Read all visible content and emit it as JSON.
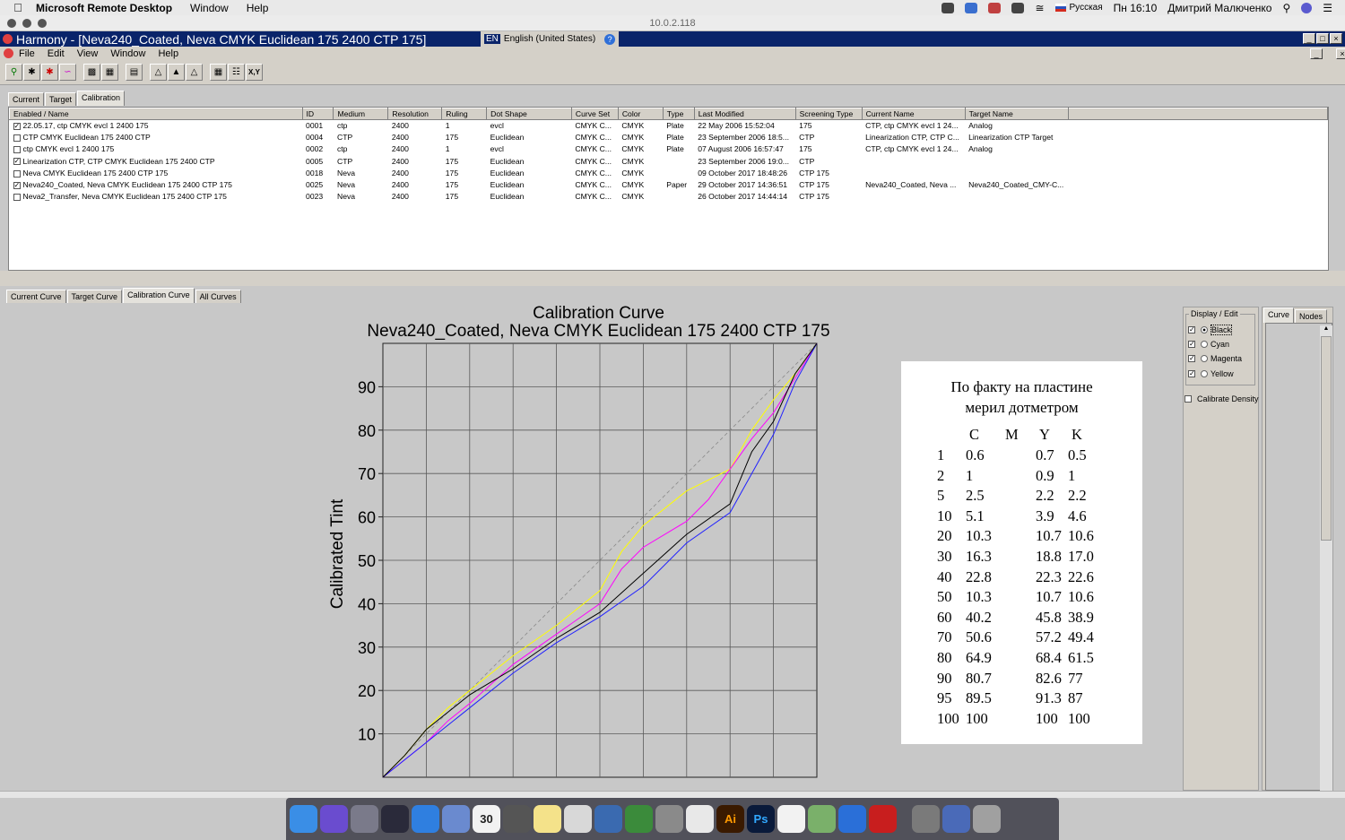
{
  "mac_menubar": {
    "app_name": "Microsoft Remote Desktop",
    "menus": [
      "Window",
      "Help"
    ],
    "input_source": "Русская",
    "clock": "Пн 16:10",
    "user": "Дмитрий Малюченко"
  },
  "rdp_title": "10.0.2.118",
  "window": {
    "title": "Harmony - [Neva240_Coated, Neva CMYK Euclidean 175 2400 CTP 175]",
    "lang_code": "EN",
    "lang_name": "English (United States)"
  },
  "menubar": [
    "File",
    "Edit",
    "View",
    "Window",
    "Help"
  ],
  "toolbar": {
    "xy_label": "X,Y"
  },
  "upper_tabs": [
    "Current",
    "Target",
    "Calibration"
  ],
  "upper_active_tab": "Calibration",
  "table": {
    "columns": [
      "Enabled / Name",
      "ID",
      "Medium",
      "Resolution",
      "Ruling",
      "Dot Shape",
      "Curve Set",
      "Color",
      "Type",
      "Last Modified",
      "Screening Type",
      "Current Name",
      "Target Name"
    ],
    "rows": [
      {
        "checked": true,
        "cells": [
          "22.05.17, ctp CMYK evcl 1 2400 175",
          "0001",
          "ctp",
          "2400",
          "1",
          "evcl",
          "CMYK C...",
          "CMYK",
          "Plate",
          "22 May 2006 15:52:04",
          "175",
          "CTP, ctp CMYK evcl 1 24...",
          "Analog"
        ]
      },
      {
        "checked": false,
        "cells": [
          "CTP CMYK Euclidean 175 2400 CTP",
          "0004",
          "CTP",
          "2400",
          "175",
          "Euclidean",
          "CMYK C...",
          "CMYK",
          "Plate",
          "23 September 2006 18:5...",
          "CTP",
          "Linearization CTP, CTP C...",
          "Linearization CTP Target"
        ]
      },
      {
        "checked": false,
        "cells": [
          "ctp CMYK evcl 1 2400 175",
          "0002",
          "ctp",
          "2400",
          "1",
          "evcl",
          "CMYK C...",
          "CMYK",
          "Plate",
          "07 August 2006 16:57:47",
          "175",
          "CTP, ctp CMYK evcl 1 24...",
          "Analog"
        ]
      },
      {
        "checked": true,
        "cells": [
          "Linearization CTP, CTP CMYK Euclidean 175 2400 CTP",
          "0005",
          "CTP",
          "2400",
          "175",
          "Euclidean",
          "CMYK C...",
          "CMYK",
          "",
          "23 September 2006 19:0...",
          "CTP",
          "",
          ""
        ]
      },
      {
        "checked": false,
        "cells": [
          "Neva CMYK Euclidean 175 2400 CTP 175",
          "0018",
          "Neva",
          "2400",
          "175",
          "Euclidean",
          "CMYK C...",
          "CMYK",
          "",
          "09 October 2017 18:48:26",
          "CTP 175",
          "",
          ""
        ]
      },
      {
        "checked": true,
        "cells": [
          "Neva240_Coated, Neva CMYK Euclidean 175 2400 CTP 175",
          "0025",
          "Neva",
          "2400",
          "175",
          "Euclidean",
          "CMYK C...",
          "CMYK",
          "Paper",
          "29 October 2017 14:36:51",
          "CTP 175",
          "Neva240_Coated, Neva ...",
          "Neva240_Coated_CMY-C..."
        ]
      },
      {
        "checked": false,
        "cells": [
          "Neva2_Transfer, Neva CMYK Euclidean 175 2400 CTP 175",
          "0023",
          "Neva",
          "2400",
          "175",
          "Euclidean",
          "CMYK C...",
          "CMYK",
          "",
          "26 October 2017 14:44:14",
          "CTP 175",
          "",
          ""
        ]
      }
    ]
  },
  "lower_tabs": [
    "Current Curve",
    "Target Curve",
    "Calibration Curve",
    "All Curves"
  ],
  "lower_active_tab": "Calibration Curve",
  "display_edit": {
    "title": "Display / Edit",
    "channels": [
      {
        "label": "Black",
        "checked": true,
        "selected": true
      },
      {
        "label": "Cyan",
        "checked": true,
        "selected": false
      },
      {
        "label": "Magenta",
        "checked": true,
        "selected": false
      },
      {
        "label": "Yellow",
        "checked": true,
        "selected": false
      }
    ],
    "calibrate_density": "Calibrate Density"
  },
  "right_tabs": [
    "Curve",
    "Nodes"
  ],
  "chart_data": {
    "type": "line",
    "title": "Calibration Curve",
    "subtitle": "Neva240_Coated, Neva CMYK Euclidean 175 2400 CTP 175",
    "xlabel": "",
    "ylabel": "Calibrated Tint",
    "xlim": [
      0,
      100
    ],
    "ylim": [
      0,
      100
    ],
    "yticks": [
      10,
      20,
      30,
      40,
      50,
      60,
      70,
      80,
      90
    ],
    "grid": true,
    "series": [
      {
        "color": "#8a8a8a",
        "style": "dashed",
        "x": [
          0,
          100
        ],
        "y": [
          0,
          100
        ]
      },
      {
        "color": "#ffff00",
        "x": [
          0,
          5,
          10,
          15,
          20,
          30,
          40,
          50,
          55,
          60,
          70,
          80,
          85,
          90,
          95,
          100
        ],
        "y": [
          0,
          5,
          11,
          16,
          20,
          28,
          35,
          43,
          52,
          58,
          66,
          71,
          80,
          87,
          93,
          100
        ]
      },
      {
        "color": "#ff00ff",
        "x": [
          0,
          5,
          10,
          15,
          20,
          30,
          40,
          50,
          55,
          60,
          70,
          75,
          80,
          85,
          90,
          95,
          100
        ],
        "y": [
          0,
          4,
          8,
          13,
          17,
          26,
          33,
          40,
          48,
          53,
          59,
          64,
          71,
          78,
          84,
          92,
          100
        ]
      },
      {
        "color": "#2020ff",
        "x": [
          0,
          5,
          10,
          15,
          20,
          30,
          40,
          50,
          60,
          70,
          80,
          85,
          90,
          95,
          100
        ],
        "y": [
          0,
          4,
          8,
          12,
          16,
          24,
          31,
          37,
          44,
          54,
          61,
          70,
          79,
          91,
          100
        ]
      },
      {
        "color": "#000000",
        "x": [
          0,
          5,
          10,
          15,
          20,
          30,
          40,
          50,
          60,
          70,
          80,
          85,
          90,
          95,
          100
        ],
        "y": [
          0,
          5,
          11,
          15,
          19,
          25,
          32,
          38,
          47,
          56,
          63,
          75,
          82,
          93,
          100
        ]
      }
    ]
  },
  "note": {
    "heading_line1": "По факту на пластине",
    "heading_line2": "мерил дотметром",
    "columns": [
      "C",
      "M",
      "Y",
      "K"
    ],
    "rows": [
      [
        "1",
        "0.6",
        "",
        "0.7",
        "0.5"
      ],
      [
        "2",
        "1",
        "",
        "0.9",
        "1"
      ],
      [
        "5",
        "2.5",
        "",
        "2.2",
        "2.2"
      ],
      [
        "10",
        "5.1",
        "",
        "3.9",
        "4.6"
      ],
      [
        "20",
        "10.3",
        "",
        "10.7",
        "10.6"
      ],
      [
        "30",
        "16.3",
        "",
        "18.8",
        "17.0"
      ],
      [
        "40",
        "22.8",
        "",
        "22.3",
        "22.6"
      ],
      [
        "50",
        "10.3",
        "",
        "10.7",
        "10.6"
      ],
      [
        "60",
        "40.2",
        "",
        "45.8",
        "38.9"
      ],
      [
        "70",
        "50.6",
        "",
        "57.2",
        "49.4"
      ],
      [
        "80",
        "64.9",
        "",
        "68.4",
        "61.5"
      ],
      [
        "90",
        "80.7",
        "",
        "82.6",
        "77"
      ],
      [
        "95",
        "89.5",
        "",
        "91.3",
        "87"
      ],
      [
        "100",
        "100",
        "",
        "100",
        "100"
      ]
    ]
  },
  "dock_apps": [
    "Finder",
    "Siri",
    "Launchpad",
    "Mission Control",
    "Safari",
    "Mail",
    "Calendar",
    "Calculator",
    "Notes",
    "Preview",
    "Thunderbird",
    "Git",
    "System Preferences",
    "Remote",
    "Illustrator",
    "Photoshop",
    "Acrobat",
    "Archive",
    "TeamViewer",
    "Acrobat Reader",
    "Photos",
    "Downloads",
    "Trash"
  ],
  "dock_calendar_day": "30",
  "dock_labels": {
    "ai": "Ai",
    "ps": "Ps"
  }
}
